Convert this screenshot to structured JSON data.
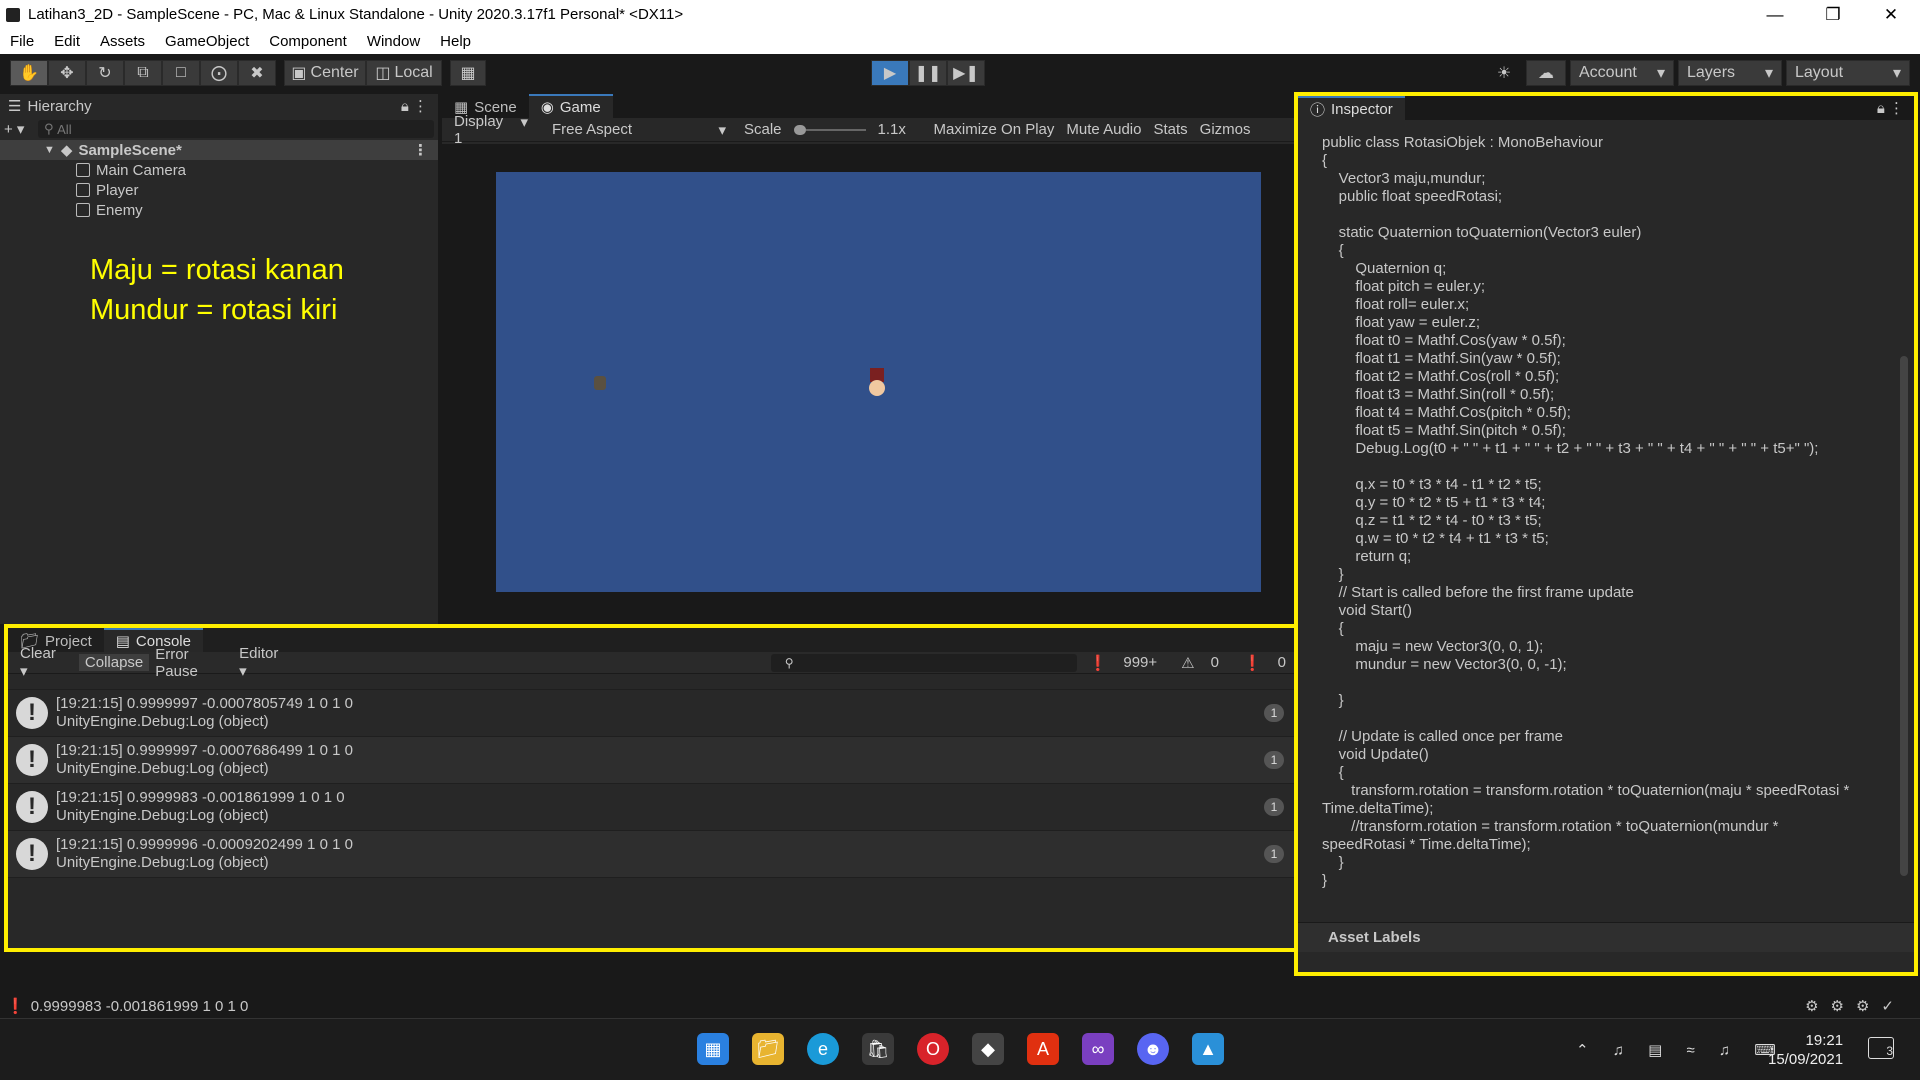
{
  "window": {
    "title": "Latihan3_2D - SampleScene - PC, Mac & Linux Standalone - Unity 2020.3.17f1 Personal* <DX11>"
  },
  "menu": [
    "File",
    "Edit",
    "Assets",
    "GameObject",
    "Component",
    "Window",
    "Help"
  ],
  "toolbar": {
    "center_label": "Center",
    "local_label": "Local",
    "account_label": "Account",
    "layers_label": "Layers",
    "layout_label": "Layout"
  },
  "hierarchy": {
    "tab_label": "Hierarchy",
    "search_placeholder": "All",
    "scene_name": "SampleScene*",
    "items": [
      "Main Camera",
      "Player",
      "Enemy"
    ]
  },
  "annotation": {
    "line1": "Maju = rotasi kanan",
    "line2": "Mundur = rotasi kiri"
  },
  "game": {
    "tab_scene": "Scene",
    "tab_game": "Game",
    "display": "Display 1",
    "aspect": "Free Aspect",
    "scale_label": "Scale",
    "scale_value": "1.1x",
    "maximize": "Maximize On Play",
    "mute": "Mute Audio",
    "stats": "Stats",
    "gizmos": "Gizmos"
  },
  "console": {
    "tab_project": "Project",
    "tab_console": "Console",
    "clear": "Clear",
    "collapse": "Collapse",
    "error_pause": "Error Pause",
    "editor": "Editor",
    "log_count": "999+",
    "warn_count": "0",
    "error_count": "0",
    "rows": [
      {
        "line1": "[19:21:15] 0.9999997 -0.0007805749 1 0 1  0",
        "line2": "UnityEngine.Debug:Log (object)",
        "count": "1"
      },
      {
        "line1": "[19:21:15] 0.9999997 -0.0007686499 1 0 1  0",
        "line2": "UnityEngine.Debug:Log (object)",
        "count": "1"
      },
      {
        "line1": "[19:21:15] 0.9999983 -0.001861999 1 0 1  0",
        "line2": "UnityEngine.Debug:Log (object)",
        "count": "1"
      },
      {
        "line1": "[19:21:15] 0.9999996 -0.0009202499 1 0 1  0",
        "line2": "UnityEngine.Debug:Log (object)",
        "count": "1"
      }
    ]
  },
  "inspector": {
    "tab_label": "Inspector",
    "code": "public class RotasiObjek : MonoBehaviour\n{\n    Vector3 maju,mundur;\n    public float speedRotasi;\n\n    static Quaternion toQuaternion(Vector3 euler)\n    {\n        Quaternion q;\n        float pitch = euler.y;\n        float roll= euler.x;\n        float yaw = euler.z;\n        float t0 = Mathf.Cos(yaw * 0.5f);\n        float t1 = Mathf.Sin(yaw * 0.5f);\n        float t2 = Mathf.Cos(roll * 0.5f);\n        float t3 = Mathf.Sin(roll * 0.5f);\n        float t4 = Mathf.Cos(pitch * 0.5f);\n        float t5 = Mathf.Sin(pitch * 0.5f);\n        Debug.Log(t0 + \" \" + t1 + \" \" + t2 + \" \" + t3 + \" \" + t4 + \" \" + \" \" + t5+\" \");\n\n        q.x = t0 * t3 * t4 - t1 * t2 * t5;\n        q.y = t0 * t2 * t5 + t1 * t3 * t4;\n        q.z = t1 * t2 * t4 - t0 * t3 * t5;\n        q.w = t0 * t2 * t4 + t1 * t3 * t5;\n        return q;\n    }\n    // Start is called before the first frame update\n    void Start()\n    {\n        maju = new Vector3(0, 0, 1);\n        mundur = new Vector3(0, 0, -1);\n\n    }\n\n    // Update is called once per frame\n    void Update()\n    {\n       transform.rotation = transform.rotation * toQuaternion(maju * speedRotasi *\nTime.deltaTime);\n       //transform.rotation = transform.rotation * toQuaternion(mundur *\nspeedRotasi * Time.deltaTime);\n    }\n}",
    "asset_labels": "Asset Labels"
  },
  "status": {
    "text": "0.9999983 -0.001861999 1 0 1  0"
  },
  "taskbar": {
    "time": "19:21",
    "date": "15/09/2021",
    "notif_count": "3"
  },
  "colors": {
    "highlight": "#ffee00",
    "game_bg": "#31508a",
    "play_active": "#3a79bb"
  }
}
